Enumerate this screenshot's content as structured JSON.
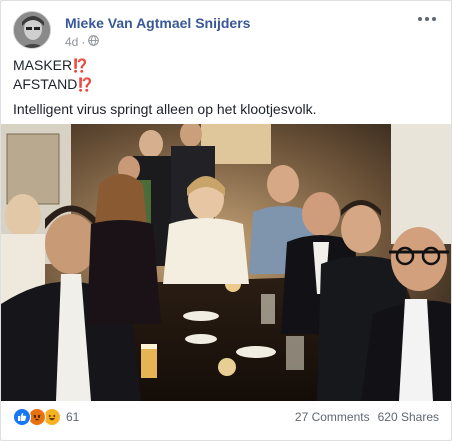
{
  "post": {
    "author": "Mieke Van Agtmael Snijders",
    "timestamp": "4d",
    "privacy_icon": "globe-icon",
    "lines": [
      "MASKER",
      "AFSTAND"
    ],
    "emoji": "⁉️",
    "body": "Intelligent virus springt alleen op het klootjesvolk."
  },
  "footer": {
    "reaction_icons": [
      "like-icon",
      "angry-icon",
      "haha-icon"
    ],
    "reaction_count": "61",
    "comments": "27 Comments",
    "shares": "620 Shares"
  },
  "colors": {
    "author_link": "#385898",
    "like_blue": "#1877f2",
    "angry_orange": "#e9710f",
    "haha_yellow": "#f7b125"
  }
}
